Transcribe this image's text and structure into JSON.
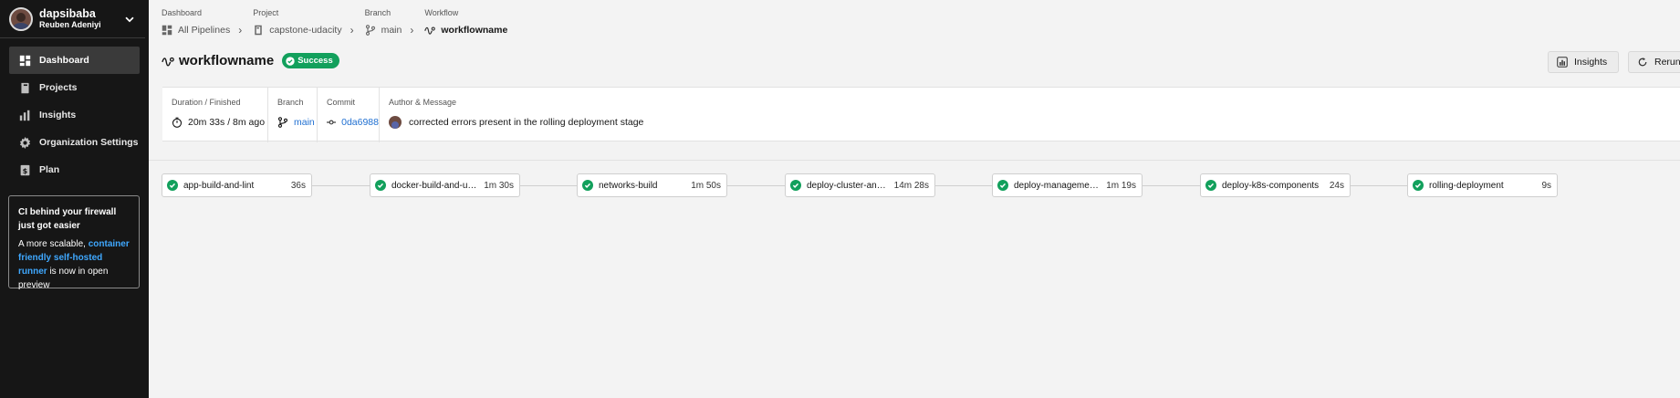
{
  "user": {
    "username": "dapsibaba",
    "full_name": "Reuben Adeniyi"
  },
  "nav": {
    "items": [
      {
        "label": "Dashboard",
        "icon": "dashboard-icon",
        "active": true
      },
      {
        "label": "Projects",
        "icon": "projects-icon",
        "active": false
      },
      {
        "label": "Insights",
        "icon": "insights-icon",
        "active": false
      },
      {
        "label": "Organization Settings",
        "icon": "gear-icon",
        "active": false
      },
      {
        "label": "Plan",
        "icon": "plan-icon",
        "active": false
      }
    ]
  },
  "promo": {
    "title": "CI behind your firewall just got easier",
    "prefix": "A more scalable,",
    "link": "container friendly self-hosted runner",
    "suffix": "is now in open preview"
  },
  "breadcrumb": {
    "dashboard_label": "Dashboard",
    "dashboard_value": "All Pipelines",
    "project_label": "Project",
    "project_value": "capstone-udacity",
    "branch_label": "Branch",
    "branch_value": "main",
    "workflow_label": "Workflow",
    "workflow_value": "workflowname"
  },
  "workflow": {
    "name": "workflowname",
    "status": "Success",
    "status_color": "#12a05c"
  },
  "actions": {
    "insights": "Insights",
    "rerun": "Rerun"
  },
  "info": {
    "duration_label": "Duration / Finished",
    "duration_value": "20m 33s / 8m ago",
    "branch_label": "Branch",
    "branch_value": "main",
    "commit_label": "Commit",
    "commit_value": "0da6988",
    "author_label": "Author & Message",
    "message": "corrected errors present in the rolling deployment stage"
  },
  "jobs": [
    {
      "name": "app-build-and-lint",
      "duration": "36s",
      "status": "success"
    },
    {
      "name": "docker-build-and-uplo...",
      "duration": "1m 30s",
      "status": "success"
    },
    {
      "name": "networks-build",
      "duration": "1m 50s",
      "status": "success"
    },
    {
      "name": "deploy-cluster-and-n...",
      "duration": "14m 28s",
      "status": "success"
    },
    {
      "name": "deploy-management-...",
      "duration": "1m 19s",
      "status": "success"
    },
    {
      "name": "deploy-k8s-components",
      "duration": "24s",
      "status": "success"
    },
    {
      "name": "rolling-deployment",
      "duration": "9s",
      "status": "success"
    }
  ]
}
